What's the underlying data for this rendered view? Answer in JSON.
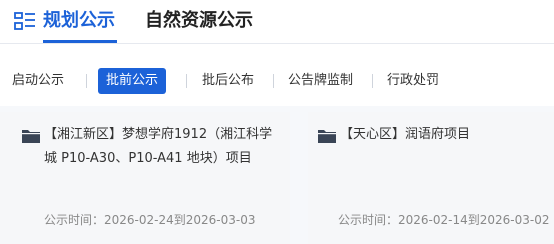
{
  "header": {
    "icon": "list-icon",
    "tabs": [
      {
        "label": "规划公示",
        "active": true
      },
      {
        "label": "自然资源公示",
        "active": false
      }
    ],
    "accent_color": "#1c62d8"
  },
  "filters": [
    {
      "label": "启动公示",
      "active": false
    },
    {
      "label": "批前公示",
      "active": true
    },
    {
      "label": "批后公布",
      "active": false
    },
    {
      "label": "公告牌监制",
      "active": false
    },
    {
      "label": "行政处罚",
      "active": false
    }
  ],
  "cards": [
    {
      "icon": "folder-icon",
      "title": "【湘江新区】梦想学府1912（湘江科学城 P10-A30、P10-A41 地块）项目",
      "date_label": "公示时间：2026-02-24到2026-03-03"
    },
    {
      "icon": "folder-icon",
      "title": "【天心区】润语府项目",
      "date_label": "公示时间：2026-02-14到2026-03-02"
    }
  ]
}
